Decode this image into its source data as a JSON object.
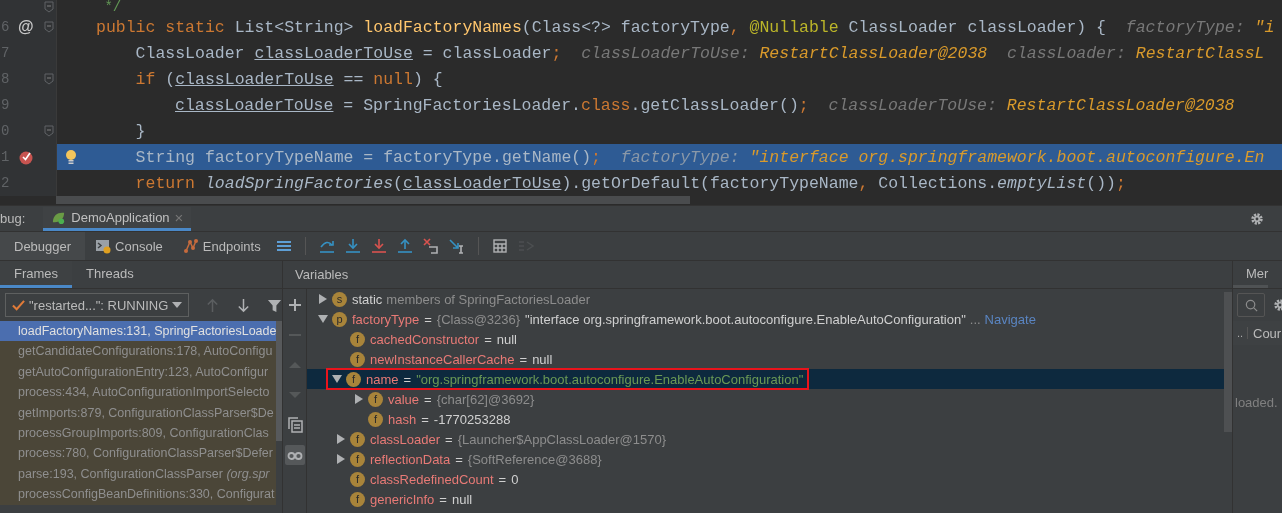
{
  "editor": {
    "lines": [
      {
        "fold": true,
        "breakpoint": false,
        "bulb": false,
        "current": false,
        "tokens": [
          {
            "kind": "comment",
            "text": " */"
          }
        ]
      },
      {
        "number": "6",
        "gutter_mark": "@",
        "fold": true,
        "breakpoint": false,
        "bulb": false,
        "current": false,
        "tokens": [
          {
            "kind": "keyword",
            "text": "public static "
          },
          {
            "kind": "text",
            "text": "List<String> "
          },
          {
            "kind": "method",
            "text": "loadFactoryNames"
          },
          {
            "kind": "text",
            "text": "(Class<?> factoryType"
          },
          {
            "kind": "punct",
            "text": ", "
          },
          {
            "kind": "annotation",
            "text": "@Nullable"
          },
          {
            "kind": "text",
            "text": " ClassLoader classLoader) {"
          },
          {
            "kind": "hint",
            "text": "  factoryType: "
          },
          {
            "kind": "value",
            "text": "\"i"
          }
        ]
      },
      {
        "number": "7",
        "fold": false,
        "breakpoint": false,
        "bulb": false,
        "current": false,
        "tokens": [
          {
            "kind": "text",
            "text": "    ClassLoader "
          },
          {
            "kind": "var",
            "text": "classLoaderToUse"
          },
          {
            "kind": "text",
            "text": " = classLoader"
          },
          {
            "kind": "punct",
            "text": ";"
          },
          {
            "kind": "hint",
            "text": "  classLoaderToUse: "
          },
          {
            "kind": "value",
            "text": "RestartClassLoader@2038"
          },
          {
            "kind": "hint",
            "text": "  classLoader: "
          },
          {
            "kind": "value",
            "text": "RestartClassL"
          }
        ]
      },
      {
        "number": "8",
        "fold": true,
        "breakpoint": false,
        "bulb": false,
        "current": false,
        "tokens": [
          {
            "kind": "keyword",
            "text": "    if "
          },
          {
            "kind": "text",
            "text": "("
          },
          {
            "kind": "var",
            "text": "classLoaderToUse"
          },
          {
            "kind": "text",
            "text": " == "
          },
          {
            "kind": "keyword",
            "text": "null"
          },
          {
            "kind": "text",
            "text": ") {"
          }
        ]
      },
      {
        "number": "9",
        "fold": false,
        "breakpoint": false,
        "bulb": false,
        "current": false,
        "tokens": [
          {
            "kind": "var",
            "text": "classLoaderToUse",
            "indent": true
          },
          {
            "kind": "text",
            "text": " = SpringFactoriesLoader."
          },
          {
            "kind": "keyword",
            "text": "class"
          },
          {
            "kind": "text",
            "text": ".getClassLoader()"
          },
          {
            "kind": "punct",
            "text": ";"
          },
          {
            "kind": "hint",
            "text": "  classLoaderToUse: "
          },
          {
            "kind": "value",
            "text": "RestartClassLoader@2038"
          }
        ]
      },
      {
        "number": "0",
        "fold": true,
        "breakpoint": false,
        "bulb": false,
        "current": false,
        "tokens": [
          {
            "kind": "text",
            "text": "    }"
          }
        ]
      },
      {
        "number": "1",
        "fold": false,
        "breakpoint": true,
        "bulb": true,
        "current": true,
        "tokens": [
          {
            "kind": "text",
            "text": "    String factoryTypeName = factoryType.getName()"
          },
          {
            "kind": "punct",
            "text": ";"
          },
          {
            "kind": "hint",
            "text": "  factoryType: "
          },
          {
            "kind": "value",
            "text": "\"interface org.springframework.boot.autoconfigure.En"
          }
        ]
      },
      {
        "number": "2",
        "fold": false,
        "breakpoint": false,
        "bulb": false,
        "current": false,
        "tokens": [
          {
            "kind": "keyword",
            "text": "    return "
          },
          {
            "kind": "italic",
            "text": "loadSpringFactories"
          },
          {
            "kind": "text",
            "text": "("
          },
          {
            "kind": "var",
            "text": "classLoaderToUse"
          },
          {
            "kind": "text",
            "text": ").getOrDefault(factoryTypeName"
          },
          {
            "kind": "punct",
            "text": ", "
          },
          {
            "kind": "text",
            "text": "Collections."
          },
          {
            "kind": "italic",
            "text": "emptyList"
          },
          {
            "kind": "text",
            "text": "())"
          },
          {
            "kind": "punct",
            "text": ";"
          }
        ]
      }
    ]
  },
  "debug": {
    "label": "bug:",
    "session_tab": {
      "label": "DemoApplication",
      "close": "×"
    },
    "tabs": [
      {
        "label": "Debugger",
        "selected": true
      },
      {
        "label": "Console",
        "selected": false
      },
      {
        "label": "Endpoints",
        "selected": false
      }
    ],
    "toolbar": [
      {
        "kind": "layout",
        "disabled": false
      },
      {
        "kind": "step-over",
        "disabled": false
      },
      {
        "kind": "step-into",
        "disabled": false
      },
      {
        "kind": "force-step-into",
        "disabled": false
      },
      {
        "kind": "step-out",
        "disabled": false
      },
      {
        "kind": "drop-frame",
        "disabled": false
      },
      {
        "kind": "run-to-cursor",
        "disabled": false
      },
      {
        "kind": "evaluate",
        "disabled": false
      },
      {
        "kind": "trace",
        "disabled": true
      }
    ],
    "frames_tabs": [
      {
        "label": "Frames",
        "selected": true
      },
      {
        "label": "Threads",
        "selected": false
      }
    ],
    "thread": {
      "value": "\"restarted...\": RUNNING"
    },
    "frame_nav": [
      {
        "kind": "up",
        "disabled": true
      },
      {
        "kind": "down",
        "disabled": false
      },
      {
        "kind": "filter",
        "disabled": false
      }
    ],
    "frames": [
      {
        "text": "loadFactoryNames:131, SpringFactoriesLoade",
        "selected": true
      },
      {
        "text": "getCandidateConfigurations:178, AutoConfigu",
        "selected": false
      },
      {
        "text": "getAutoConfigurationEntry:123, AutoConfigur",
        "selected": false
      },
      {
        "text": "process:434, AutoConfigurationImportSelecto",
        "selected": false
      },
      {
        "text": "getImports:879, ConfigurationClassParser$De",
        "selected": false
      },
      {
        "text": "processGroupImports:809, ConfigurationClas",
        "selected": false
      },
      {
        "text": "process:780, ConfigurationClassParser$Defer",
        "selected": false
      },
      {
        "text": "parse:193, ConfigurationClassParser *(org.spr*",
        "selected": false
      },
      {
        "text": "processConfigBeanDefinitions:330, Configurat",
        "selected": false
      }
    ],
    "variables_title": "Variables",
    "variables_toolbar": [
      {
        "kind": "add",
        "disabled": false,
        "selected": false
      },
      {
        "kind": "remove",
        "disabled": true,
        "selected": false
      },
      {
        "kind": "up",
        "disabled": true,
        "selected": false
      },
      {
        "kind": "down",
        "disabled": true,
        "selected": false
      },
      {
        "kind": "copy",
        "disabled": false,
        "selected": false
      },
      {
        "kind": "watches",
        "disabled": false,
        "selected": true
      }
    ],
    "variables": [
      {
        "kind": "static",
        "badge": "s",
        "name": "static",
        "description": "members of SpringFactoriesLoader",
        "expanded": false,
        "selected": false,
        "outlined": false
      },
      {
        "kind": "object",
        "badge": "p",
        "name": "factoryType",
        "eq": "=",
        "type": "{Class@3236}",
        "value": "\"interface org.springframework.boot.autoconfigure.EnableAutoConfiguration\"",
        "ellipsis": "...",
        "link": "Navigate",
        "expanded": true,
        "selected": false,
        "outlined": false,
        "children": [
          {
            "kind": "plain",
            "badge": "f",
            "name": "cachedConstructor",
            "eq": "=",
            "value": "null",
            "selected": false,
            "outlined": false
          },
          {
            "kind": "plain",
            "badge": "f",
            "name": "newInstanceCallerCache",
            "eq": "=",
            "value": "null",
            "selected": false,
            "outlined": false
          },
          {
            "kind": "string",
            "badge": "f",
            "name": "name",
            "eq": "=",
            "value": "\"org.springframework.boot.autoconfigure.EnableAutoConfiguration\"",
            "expanded": true,
            "selected": true,
            "outlined": true,
            "children": [
              {
                "kind": "object",
                "badge": "f",
                "name": "value",
                "eq": "=",
                "type": "{char[62]@3692}",
                "expanded": false,
                "selected": false,
                "outlined": false
              },
              {
                "kind": "plain",
                "badge": "f",
                "name": "hash",
                "eq": "=",
                "value": "-1770253288",
                "selected": false,
                "outlined": false
              }
            ]
          },
          {
            "kind": "object",
            "badge": "f",
            "name": "classLoader",
            "eq": "=",
            "type": "{Launcher$AppClassLoader@1570}",
            "expanded": false,
            "selected": false,
            "outlined": false
          },
          {
            "kind": "object",
            "badge": "f",
            "name": "reflectionData",
            "eq": "=",
            "type": "{SoftReference@3688}",
            "expanded": false,
            "selected": false,
            "outlined": false
          },
          {
            "kind": "plain",
            "badge": "f",
            "name": "classRedefinedCount",
            "eq": "=",
            "value": "0",
            "selected": false,
            "outlined": false
          },
          {
            "kind": "plain",
            "badge": "f",
            "name": "genericInfo",
            "eq": "=",
            "value": "null",
            "selected": false,
            "outlined": false
          }
        ]
      }
    ],
    "side": {
      "tab": "Mer",
      "column_1": "..",
      "column_2": "Cour",
      "message": "loaded."
    }
  }
}
